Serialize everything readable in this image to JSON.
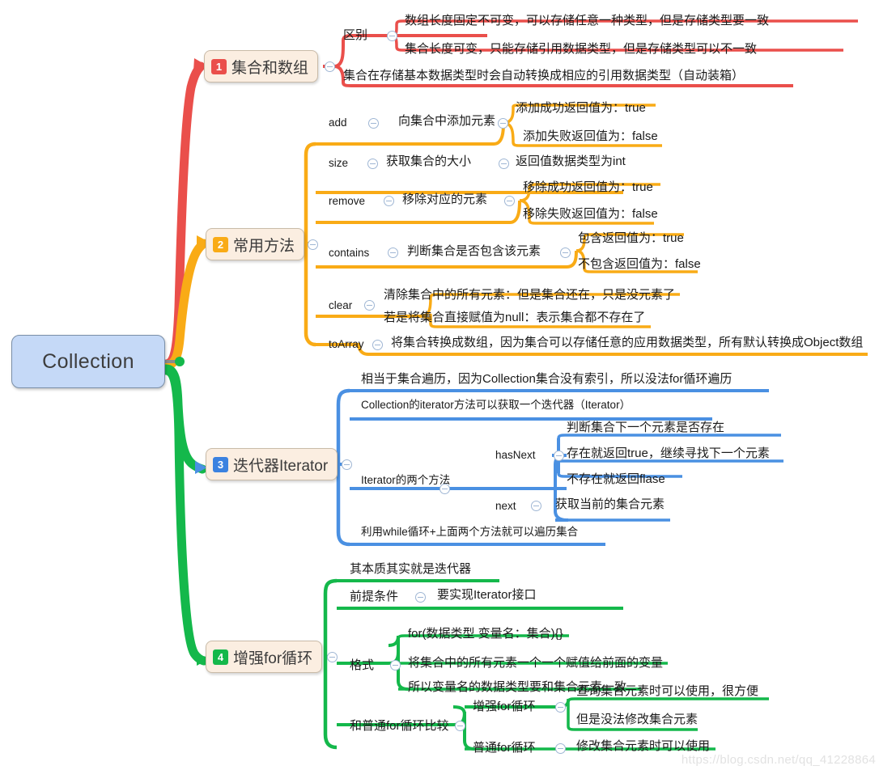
{
  "root": {
    "label": "Collection"
  },
  "watermark": "https://blog.csdn.net/qq_41228864",
  "colors": {
    "branch1": "#ea4f4b",
    "branch2": "#f9ab16",
    "branch3": "#4a90e2",
    "branch4": "#14b84b",
    "root_fill": "#c5d9f7",
    "node_fill": "#fbeee1",
    "text": "#1a1a1a"
  },
  "branches": [
    {
      "badge": "1",
      "label": "集合和数组",
      "color": "#ea4f4b",
      "children": [
        {
          "label": "区别",
          "children": [
            {
              "label": "数组长度固定不可变，可以存储任意一种类型，但是存储类型要一致"
            },
            {
              "label": "集合长度可变，只能存储引用数据类型，但是存储类型可以不一致"
            }
          ]
        },
        {
          "label": "集合在存储基本数据类型时会自动转换成相应的引用数据类型（自动装箱）",
          "children": []
        }
      ]
    },
    {
      "badge": "2",
      "label": "常用方法",
      "color": "#f9ab16",
      "children": [
        {
          "label": "add",
          "children": [
            {
              "label": "向集合中添加元素",
              "children": [
                {
                  "label": "添加成功返回值为：true"
                },
                {
                  "label": "添加失败返回值为：false"
                }
              ]
            }
          ]
        },
        {
          "label": "size",
          "children": [
            {
              "label": "获取集合的大小",
              "children": [
                {
                  "label": "返回值数据类型为int"
                }
              ]
            }
          ]
        },
        {
          "label": "remove",
          "children": [
            {
              "label": "移除对应的元素",
              "children": [
                {
                  "label": "移除成功返回值为：true"
                },
                {
                  "label": "移除失败返回值为：false"
                }
              ]
            }
          ]
        },
        {
          "label": "contains",
          "children": [
            {
              "label": "判断集合是否包含该元素",
              "children": [
                {
                  "label": "包含返回值为：true"
                },
                {
                  "label": "不包含返回值为：false"
                }
              ]
            }
          ]
        },
        {
          "label": "clear",
          "children": [
            {
              "label": "清除集合中的所有元素：但是集合还在，只是没元素了"
            },
            {
              "label": "若是将集合直接赋值为null：表示集合都不存在了"
            }
          ]
        },
        {
          "label": "toArray",
          "children": [
            {
              "label": "将集合转换成数组，因为集合可以存储任意的应用数据类型，所有默认转换成Object数组"
            }
          ]
        }
      ]
    },
    {
      "badge": "3",
      "label": "迭代器Iterator",
      "color": "#4a90e2",
      "children": [
        {
          "label": "相当于集合遍历，因为Collection集合没有索引，所以没法for循环遍历",
          "children": []
        },
        {
          "label": "Collection的iterator方法可以获取一个迭代器（Iterator）",
          "children": []
        },
        {
          "label": "Iterator的两个方法",
          "children": [
            {
              "label": "hasNext",
              "children": [
                {
                  "label": "判断集合下一个元素是否存在"
                },
                {
                  "label": "存在就返回true，继续寻找下一个元素"
                },
                {
                  "label": "不存在就返回flase"
                }
              ]
            },
            {
              "label": "next",
              "children": [
                {
                  "label": "获取当前的集合元素"
                }
              ]
            }
          ]
        },
        {
          "label": "利用while循环+上面两个方法就可以遍历集合",
          "children": []
        }
      ]
    },
    {
      "badge": "4",
      "label": "增强for循环",
      "color": "#14b84b",
      "children": [
        {
          "label": "其本质其实就是迭代器",
          "children": []
        },
        {
          "label": "前提条件",
          "children": [
            {
              "label": "要实现Iterator接口"
            }
          ]
        },
        {
          "label": "格式",
          "children": [
            {
              "label": "for(数据类型 变量名：集合){}"
            },
            {
              "label": "将集合中的所有元素一个一个赋值给前面的变量"
            },
            {
              "label": "所以变量名的数据类型要和集合元素一致"
            }
          ]
        },
        {
          "label": "和普通for循环比较",
          "children": [
            {
              "label": "增强for循环",
              "children": [
                {
                  "label": "查询集合元素时可以使用，很方便"
                },
                {
                  "label": "但是没法修改集合元素"
                }
              ]
            },
            {
              "label": "普通for循环",
              "children": [
                {
                  "label": "修改集合元素时可以使用"
                }
              ]
            }
          ]
        }
      ]
    }
  ]
}
